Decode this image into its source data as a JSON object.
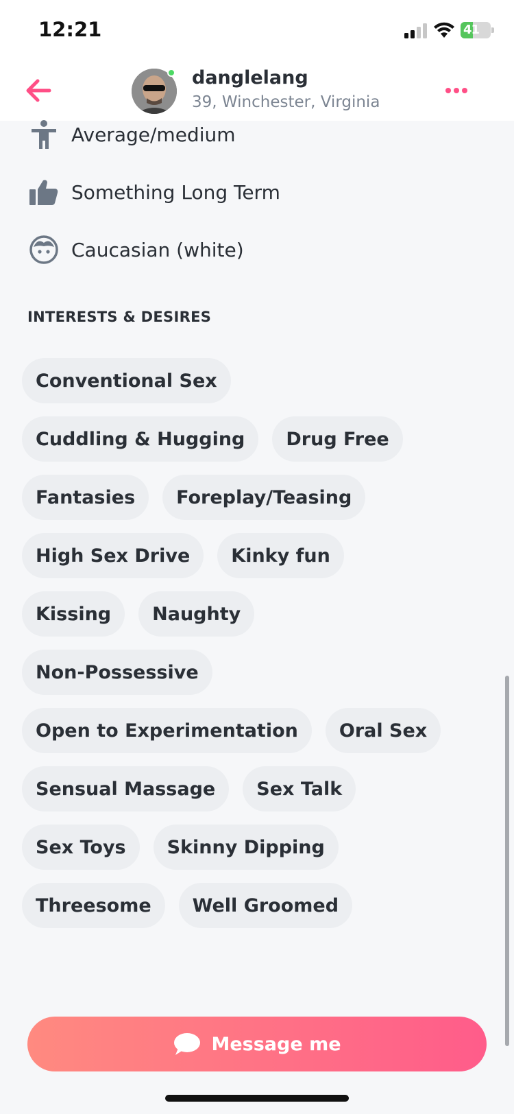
{
  "status_bar": {
    "time": "12:21",
    "battery_level": "41",
    "battery_fraction": 0.41
  },
  "header": {
    "username": "danglelang",
    "meta": "39, Winchester, Virginia",
    "online": true
  },
  "attributes": [
    {
      "icon": "body-type-icon",
      "label": "Average/medium"
    },
    {
      "icon": "thumbs-up-icon",
      "label": "Something Long Term"
    },
    {
      "icon": "face-icon",
      "label": "Caucasian (white)"
    }
  ],
  "interests": {
    "title": "INTERESTS & DESIRES",
    "rows": [
      [
        "Conventional Sex"
      ],
      [
        "Cuddling & Hugging",
        "Drug Free"
      ],
      [
        "Fantasies",
        "Foreplay/Teasing"
      ],
      [
        "High Sex Drive",
        "Kinky fun"
      ],
      [
        "Kissing",
        "Naughty"
      ],
      [
        "Non-Possessive"
      ],
      [
        "Open to Experimentation",
        "Oral Sex"
      ],
      [
        "Sensual Massage",
        "Sex Talk"
      ],
      [
        "Sex Toys",
        "Skinny Dipping"
      ],
      [
        "Threesome",
        "Well Groomed"
      ]
    ]
  },
  "message_button": {
    "label": "Message me"
  },
  "colors": {
    "accent": "#ff4f86",
    "chip_bg": "#eceef1",
    "online": "#4cd964"
  }
}
